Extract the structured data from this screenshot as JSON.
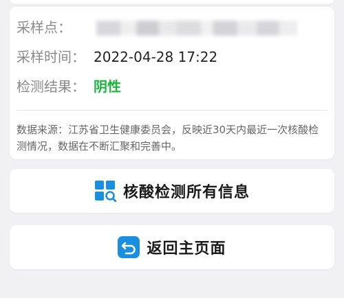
{
  "info_card": {
    "site_label": "采样点：",
    "time_label": "采样时间：",
    "time_value": "2022-04-28 17:22",
    "result_label": "检测结果：",
    "result_value": "阴性",
    "source_note": "数据来源：江苏省卫生健康委员会，反映近30天内最近一次核酸检测情况，数据在不断汇聚和完善中。"
  },
  "buttons": {
    "all_info_label": "核酸检测所有信息",
    "back_home_label": "返回主页面"
  },
  "icons": {
    "all_info": "grid-search-icon",
    "back_home": "return-arrow-icon"
  },
  "colors": {
    "result_negative": "#1bb53e",
    "icon_blue": "#1a8fe0",
    "page_background": "#f1f1f3"
  }
}
